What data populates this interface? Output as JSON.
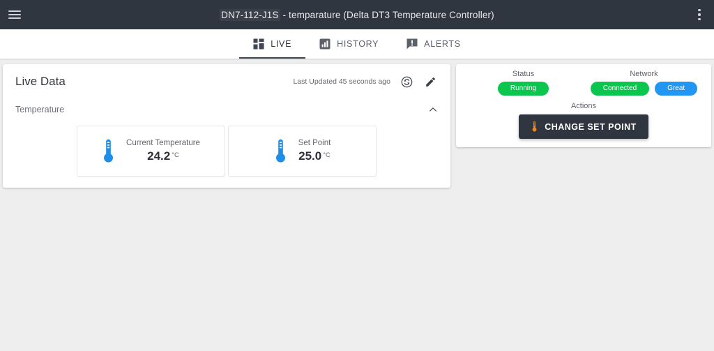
{
  "appbar": {
    "menu_icon": "hamburger-menu-icon",
    "title_prefix": "DN7-112-J1S",
    "title_suffix": " - temparature (Delta DT3 Temperature Controller)",
    "overflow_icon": "more-vertical-icon"
  },
  "tabs": [
    {
      "label": "LIVE",
      "icon": "dashboard-grid-icon",
      "active": true
    },
    {
      "label": "HISTORY",
      "icon": "bar-chart-icon",
      "active": false
    },
    {
      "label": "ALERTS",
      "icon": "announcement-icon",
      "active": false
    }
  ],
  "live_card": {
    "title": "Live Data",
    "last_updated": "Last Updated 45 seconds ago",
    "history_icon": "history-refresh-icon",
    "edit_icon": "pencil-edit-icon",
    "section": {
      "title": "Temperature",
      "collapse_icon": "chevron-up-icon"
    },
    "metrics": [
      {
        "label": "Current Temperature",
        "value": "24.2",
        "unit": "°C",
        "icon": "thermometer-icon"
      },
      {
        "label": "Set Point",
        "value": "25.0",
        "unit": "°C",
        "icon": "thermometer-icon"
      }
    ]
  },
  "status_card": {
    "status": {
      "label": "Status",
      "badges": [
        {
          "text": "Running",
          "color": "#0ac64f"
        }
      ]
    },
    "network": {
      "label": "Network",
      "badges": [
        {
          "text": "Connected",
          "color": "#0ac64f"
        },
        {
          "text": "Great",
          "color": "#2196f3"
        }
      ]
    },
    "actions": {
      "label": "Actions",
      "button_label": "CHANGE SET POINT",
      "button_icon": "thermometer-icon"
    }
  },
  "colors": {
    "appbar_bg": "#2f3640",
    "page_bg": "#eeeeee",
    "accent_blue": "#2196f3",
    "status_green": "#0ac64f",
    "action_orange": "#f0871e",
    "tab_indicator": "#3f4651"
  }
}
